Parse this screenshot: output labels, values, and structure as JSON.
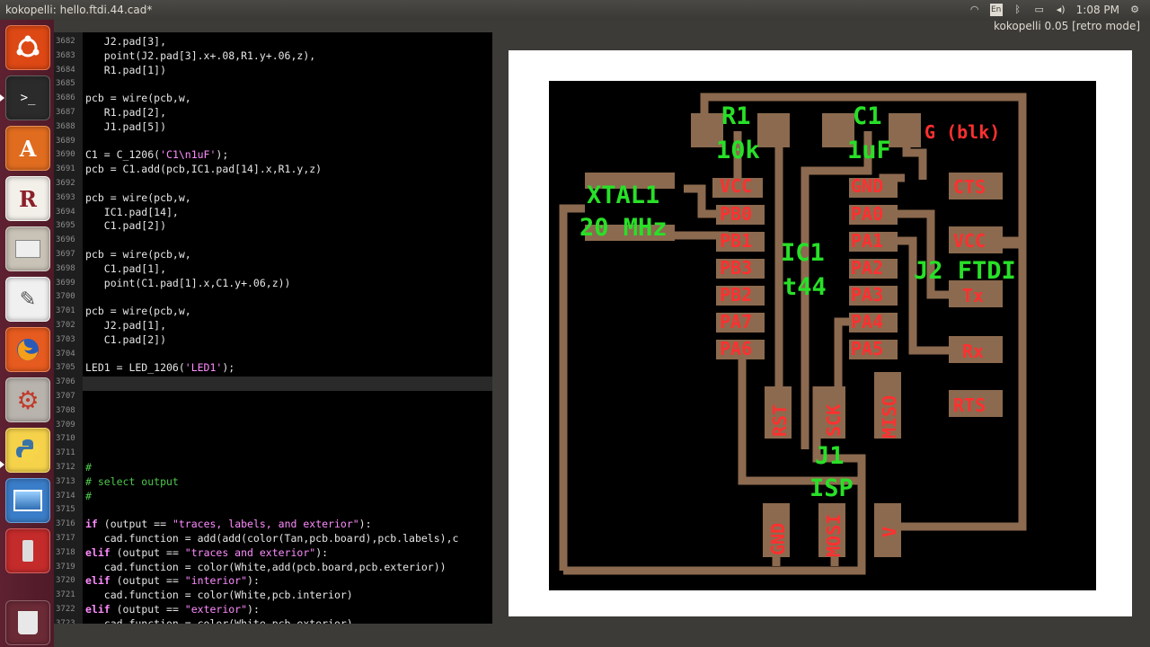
{
  "window": {
    "title": "kokopelli: hello.ftdi.44.cad*",
    "time": "1:08 PM",
    "app_label": "kokopelli 0.05 [retro mode]"
  },
  "launcher": {
    "items": [
      "ubuntu-dash",
      "terminal",
      "software-center",
      "r-editor",
      "file-manager",
      "text-editor",
      "firefox",
      "system-settings",
      "python",
      "image-viewer",
      "usb-creator",
      "trash"
    ]
  },
  "editor": {
    "first_line": 3682,
    "lines": [
      "   J2.pad[3],",
      "   point(J2.pad[3].x+.08,R1.y+.06,z),",
      "   R1.pad[1])",
      "",
      "pcb = wire(pcb,w,",
      "   R1.pad[2],",
      "   J1.pad[5])",
      "",
      "C1 = C_1206('C1\\n1uF');",
      "pcb = C1.add(pcb,IC1.pad[14].x,R1.y,z)",
      "",
      "pcb = wire(pcb,w,",
      "   IC1.pad[14],",
      "   C1.pad[2])",
      "",
      "pcb = wire(pcb,w,",
      "   C1.pad[1],",
      "   point(C1.pad[1].x,C1.y+.06,z))",
      "",
      "pcb = wire(pcb,w,",
      "   J2.pad[1],",
      "   C1.pad[2])",
      "",
      "LED1 = LED_1206('LED1');",
      "",
      "",
      "",
      "",
      "",
      "",
      "#",
      "# select output",
      "#",
      "",
      "if (output == \"traces, labels, and exterior\"):",
      "   cad.function = add(add(color(Tan,pcb.board),pcb.labels),c",
      "elif (output == \"traces and exterior\"):",
      "   cad.function = color(White,add(pcb.board,pcb.exterior))",
      "elif (output == \"interior\"):",
      "   cad.function = color(White,pcb.interior)",
      "elif (output == \"exterior\"):",
      "   cad.function = color(White,pcb.exterior)"
    ]
  },
  "pcb": {
    "labels_green": [
      "R1",
      "10k",
      "C1",
      "1uF",
      "XTAL1",
      "20 MHz",
      "IC1",
      "t44",
      "J2 FTDI",
      "J1",
      "ISP"
    ],
    "labels_red": [
      "G (blk)",
      "VCC",
      "PB0",
      "PB1",
      "PB3",
      "PB2",
      "PA7",
      "PA6",
      "GND",
      "PA0",
      "PA1",
      "PA2",
      "PA3",
      "PA4",
      "PA5",
      "CTS",
      "VCC",
      "Tx",
      "Rx",
      "RTS",
      "RST",
      "SCK",
      "MISO",
      "GND",
      "MOSI",
      "V"
    ],
    "colors": {
      "trace": "#8c6a4f",
      "pad_label": "#ff3030",
      "part_label": "#28e028",
      "background": "#000000",
      "sheet": "#ffffff"
    }
  }
}
